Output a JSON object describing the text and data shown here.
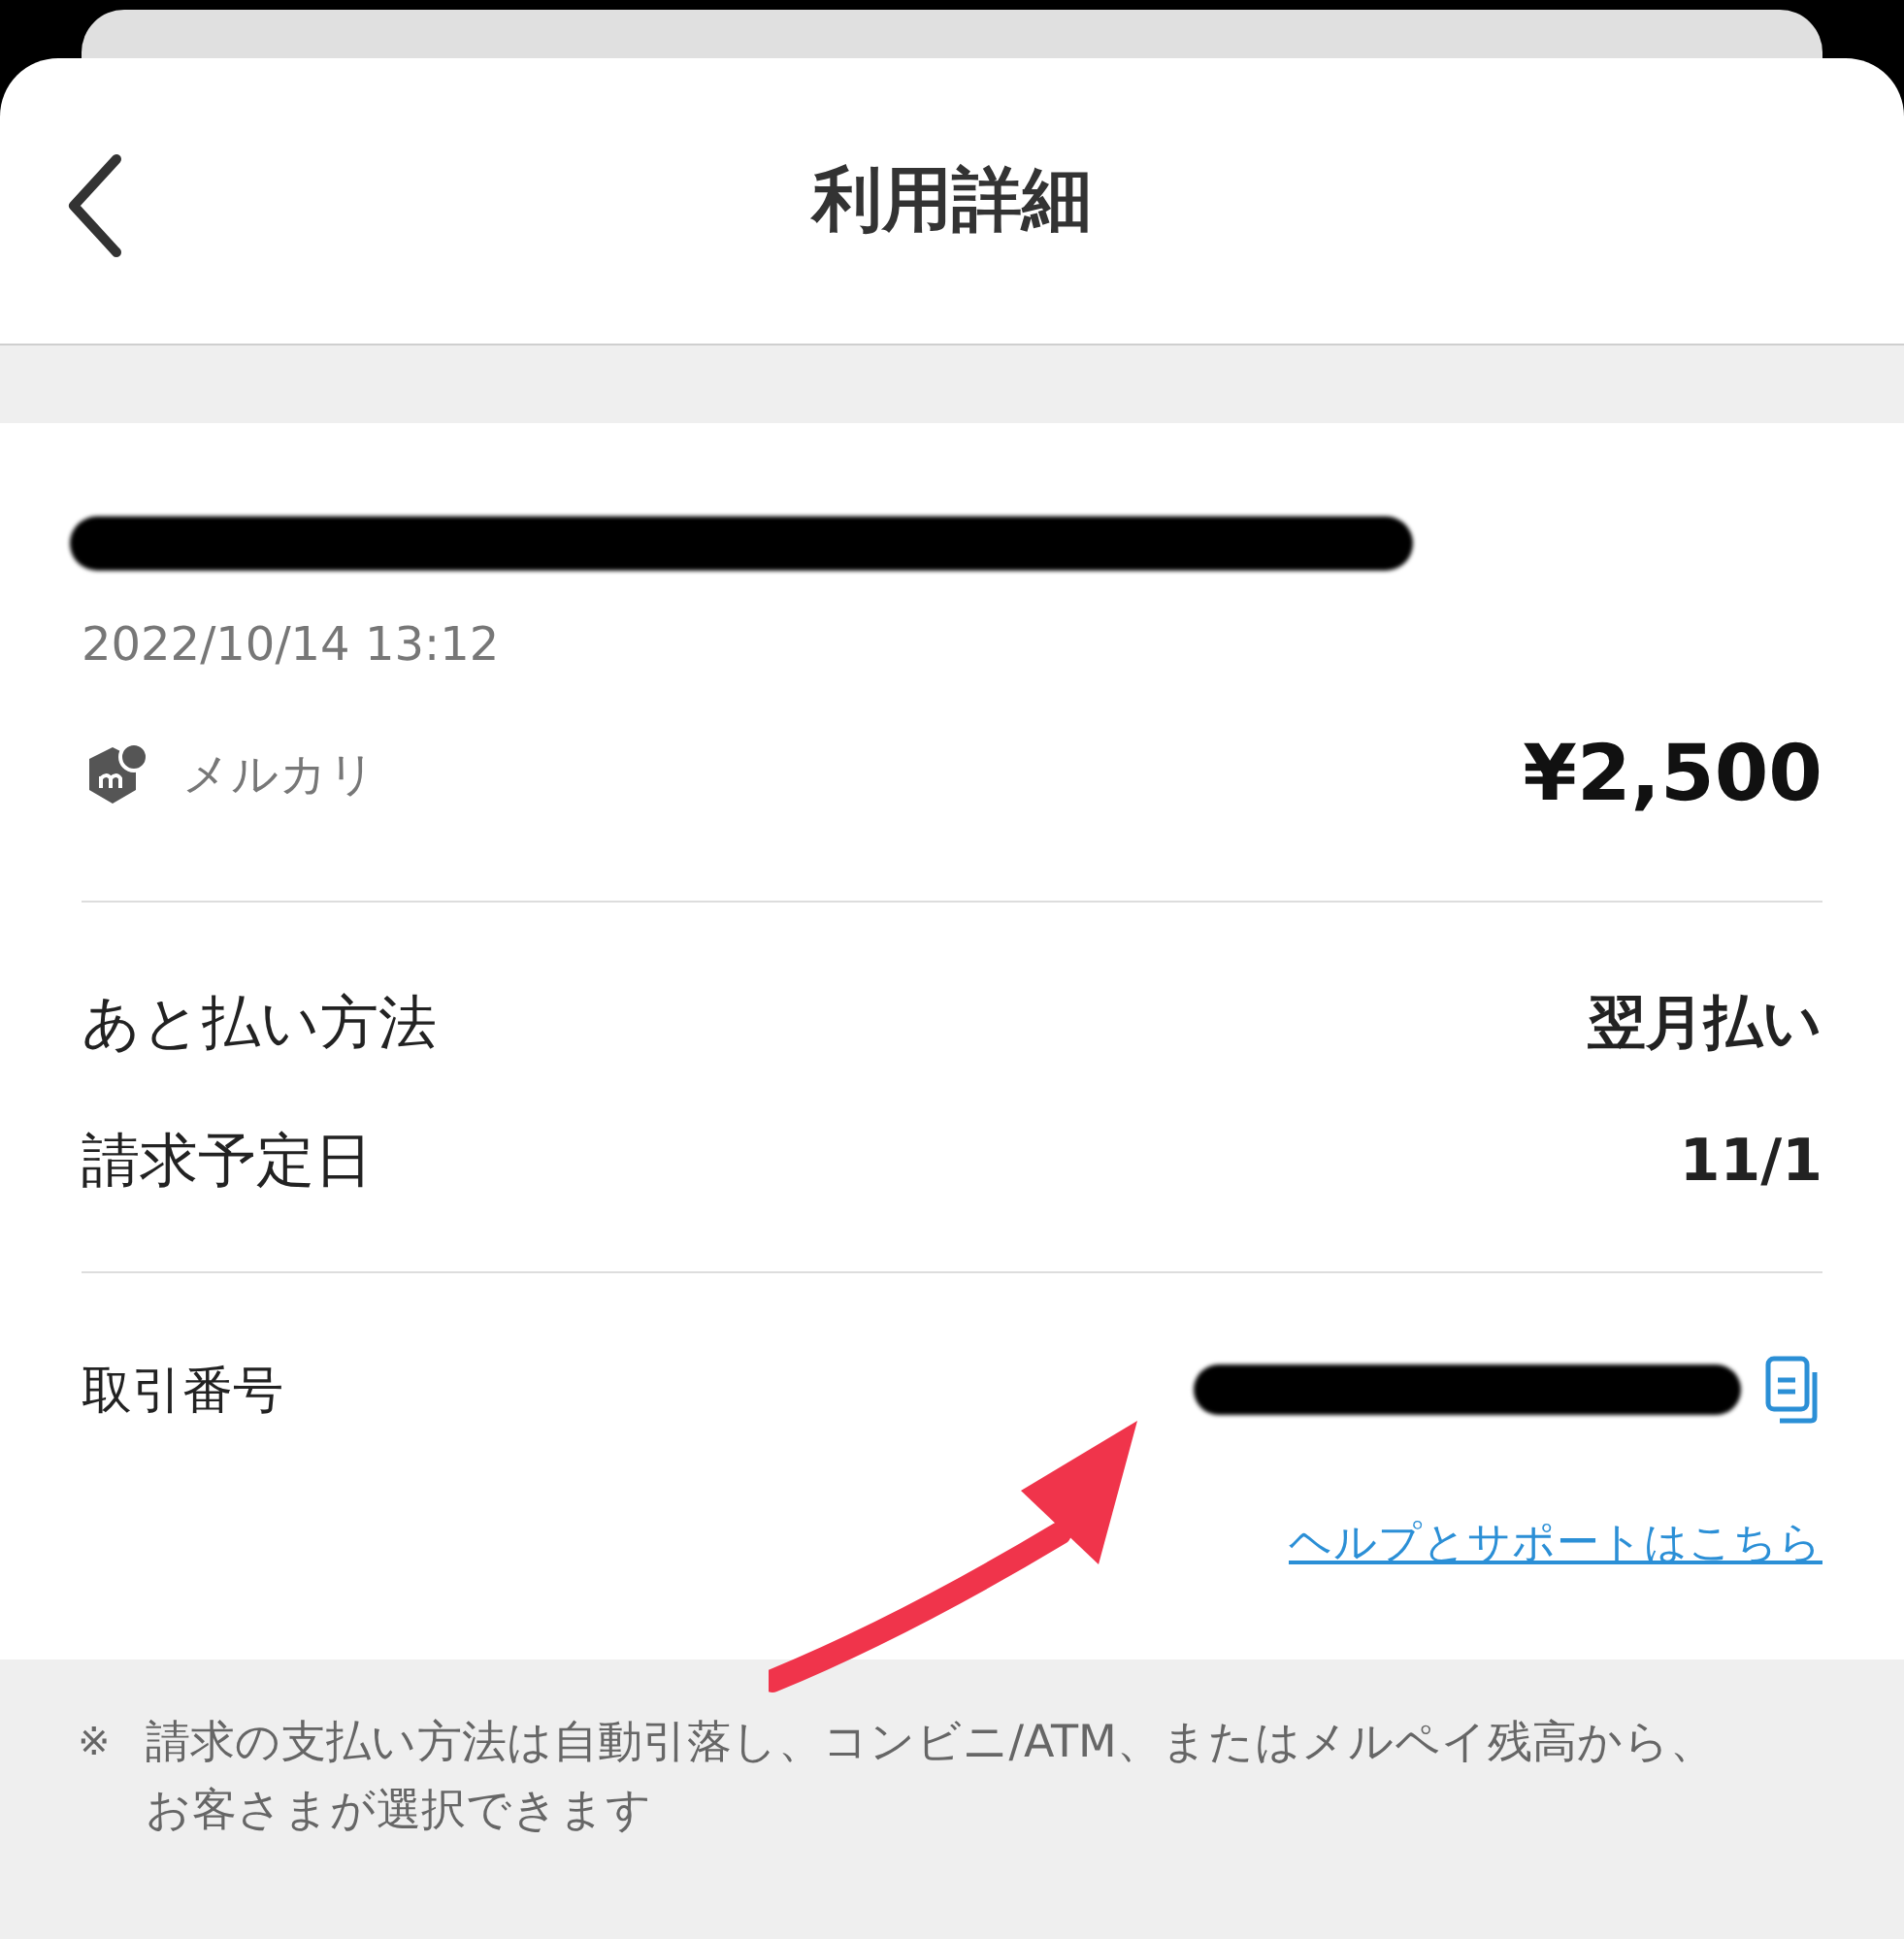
{
  "header": {
    "title": "利用詳細"
  },
  "transaction": {
    "date": "2022/10/14 13:12",
    "merchant": "メルカリ",
    "amount": "¥2,500"
  },
  "details": [
    {
      "label": "あと払い方法",
      "value": "翌月払い"
    },
    {
      "label": "請求予定日",
      "value": "11/1"
    }
  ],
  "transaction_number": {
    "label": "取引番号"
  },
  "help_link": "ヘルプとサポートはこちら",
  "note": {
    "mark": "※",
    "text": "請求の支払い方法は自動引落し、コンビニ/ATM、またはメルペイ残高から、お客さまが選択できます"
  }
}
